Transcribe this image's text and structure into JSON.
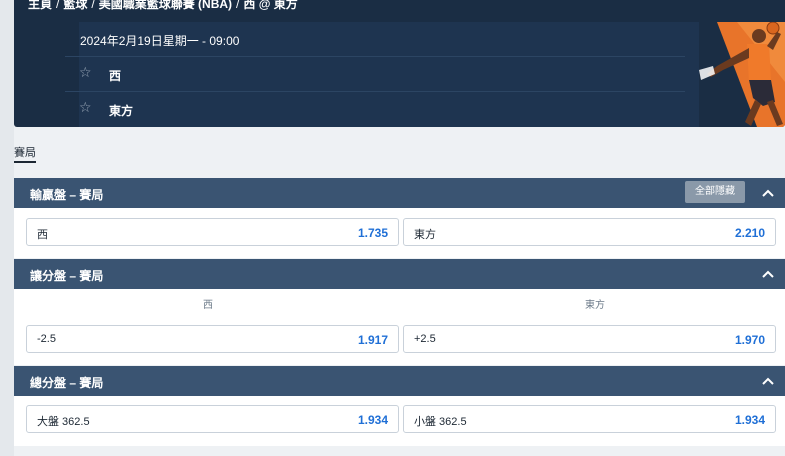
{
  "breadcrumb": [
    "主頁",
    "籃球",
    "美國職業籃球聯賽 (NBA)",
    "西 @ 東方"
  ],
  "event": {
    "datetime": "2024年2月19日星期一 - 09:00",
    "teams": [
      "西",
      "東方"
    ]
  },
  "tabs": [
    {
      "label": "賽局",
      "active": true
    }
  ],
  "markets": {
    "moneyline": {
      "title": "輸贏盤 – 賽局",
      "collapse_all": "全部隱藏",
      "options": [
        {
          "label": "西",
          "odds": "1.735"
        },
        {
          "label": "東方",
          "odds": "2.210"
        }
      ]
    },
    "handicap": {
      "title": "讓分盤 – 賽局",
      "columns": [
        "西",
        "東方"
      ],
      "options": [
        {
          "label": "-2.5",
          "odds": "1.917"
        },
        {
          "label": "+2.5",
          "odds": "1.970"
        }
      ]
    },
    "total": {
      "title": "總分盤 – 賽局",
      "options": [
        {
          "label": "大盤 362.5",
          "odds": "1.934"
        },
        {
          "label": "小盤 362.5",
          "odds": "1.934"
        }
      ]
    }
  },
  "colors": {
    "hero_bg": "#1a2d44",
    "market_header": "#3a5472",
    "odds_text": "#1f6fd6",
    "art_accent": "#e8742a"
  }
}
